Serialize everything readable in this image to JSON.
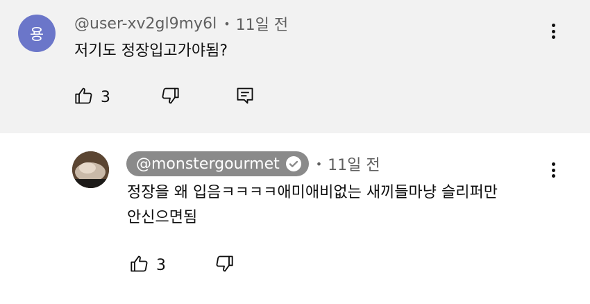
{
  "comments": [
    {
      "avatar_letter": "용",
      "avatar_color": "#6b76c9",
      "handle": "@user-xv2gl9my6l",
      "separator": "•",
      "time": "11일 전",
      "text": "저기도 정장입고가야됨?",
      "likes": "3",
      "icons": [
        "thumbs-up-icon",
        "thumbs-down-icon",
        "reply-icon",
        "more-vert-icon"
      ]
    },
    {
      "handle": "@monstergourmet",
      "verified": true,
      "separator": "•",
      "time": "11일 전",
      "text_line1": "정장을 왜 입음ㅋㅋㅋㅋ애미애비없는 새끼들마냥 슬리퍼만",
      "text_line2": "안신으면됨",
      "likes": "3",
      "icons": [
        "thumbs-up-icon",
        "thumbs-down-icon",
        "verified-check-icon",
        "more-vert-icon"
      ]
    }
  ],
  "colors": {
    "top_comment_bg": "#f2f2f2",
    "reply_bg": "#ffffff",
    "pill_bg": "#8a8a8a",
    "meta_text": "#606060"
  }
}
